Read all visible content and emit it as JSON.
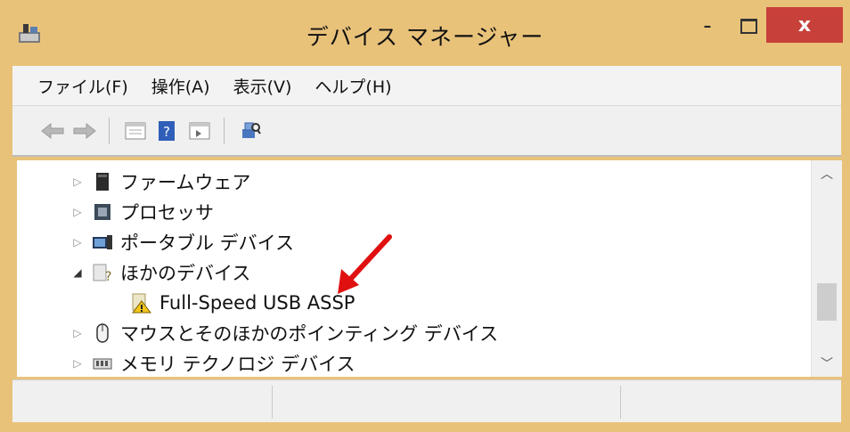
{
  "window": {
    "title": "デバイス マネージャー"
  },
  "controls": {
    "minimize": "-",
    "close": "x"
  },
  "menu": [
    {
      "label": "ファイル(F)"
    },
    {
      "label": "操作(A)"
    },
    {
      "label": "表示(V)"
    },
    {
      "label": "ヘルプ(H)"
    }
  ],
  "toolbar": {
    "buttons": [
      "back-arrow-icon",
      "forward-arrow-icon",
      "properties-icon",
      "help-icon",
      "show-hidden-icon",
      "scan-hardware-icon"
    ]
  },
  "tree": {
    "nodes": [
      {
        "label": "ファームウェア",
        "state": "collapsed",
        "icon": "firmware-icon"
      },
      {
        "label": "プロセッサ",
        "state": "collapsed",
        "icon": "processor-icon"
      },
      {
        "label": "ポータブル デバイス",
        "state": "collapsed",
        "icon": "portable-device-icon"
      },
      {
        "label": "ほかのデバイス",
        "state": "expanded",
        "icon": "unknown-device-icon"
      },
      {
        "label": "Full-Speed USB ASSP",
        "state": "child",
        "icon": "warning-device-icon"
      },
      {
        "label": "マウスとそのほかのポインティング デバイス",
        "state": "collapsed",
        "icon": "mouse-icon"
      },
      {
        "label": "メモリ テクノロジ デバイス",
        "state": "collapsed",
        "icon": "memory-icon"
      }
    ]
  },
  "scrollbar": {
    "position": 0.62
  },
  "annotation": {
    "color": "#e01010"
  }
}
